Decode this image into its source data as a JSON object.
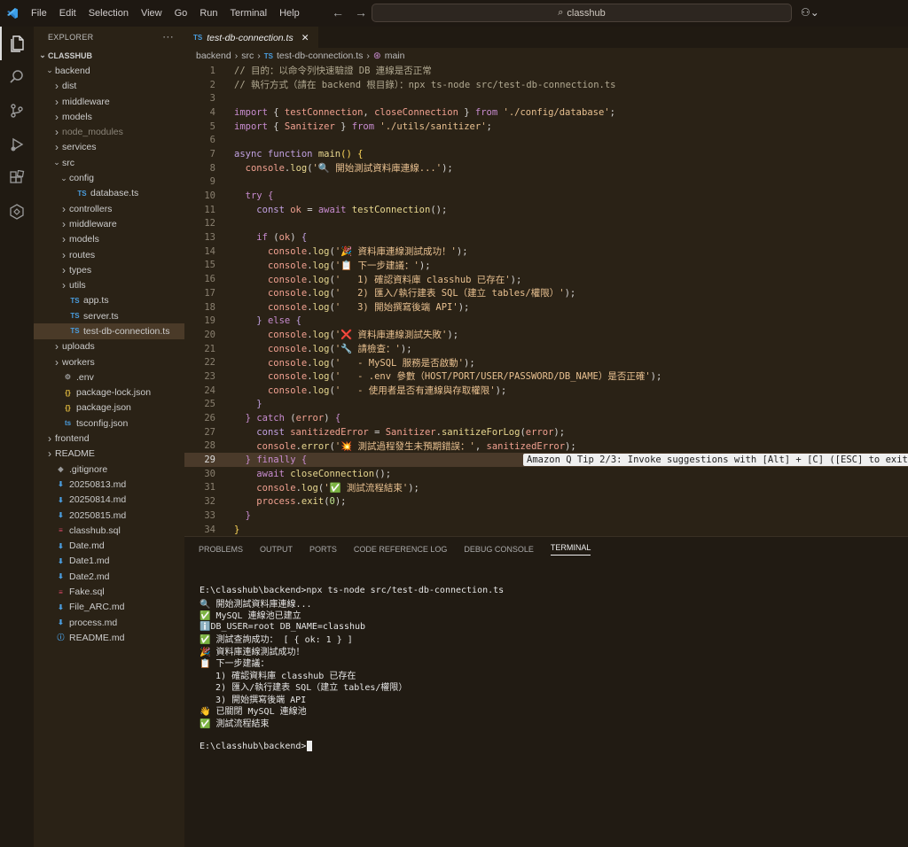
{
  "titlebar": {
    "menus": [
      "File",
      "Edit",
      "Selection",
      "View",
      "Go",
      "Run",
      "Terminal",
      "Help"
    ],
    "search": "classhub"
  },
  "explorer": {
    "title": "EXPLORER",
    "root": "CLASSHUB",
    "items": [
      {
        "label": "backend",
        "depth": 1,
        "type": "folder-open"
      },
      {
        "label": "dist",
        "depth": 2,
        "type": "folder"
      },
      {
        "label": "middleware",
        "depth": 2,
        "type": "folder"
      },
      {
        "label": "models",
        "depth": 2,
        "type": "folder"
      },
      {
        "label": "node_modules",
        "depth": 2,
        "type": "folder",
        "dim": true
      },
      {
        "label": "services",
        "depth": 2,
        "type": "folder"
      },
      {
        "label": "src",
        "depth": 2,
        "type": "folder-open"
      },
      {
        "label": "config",
        "depth": 3,
        "type": "folder-open"
      },
      {
        "label": "database.ts",
        "depth": 4,
        "type": "ts"
      },
      {
        "label": "controllers",
        "depth": 3,
        "type": "folder"
      },
      {
        "label": "middleware",
        "depth": 3,
        "type": "folder"
      },
      {
        "label": "models",
        "depth": 3,
        "type": "folder"
      },
      {
        "label": "routes",
        "depth": 3,
        "type": "folder"
      },
      {
        "label": "types",
        "depth": 3,
        "type": "folder"
      },
      {
        "label": "utils",
        "depth": 3,
        "type": "folder"
      },
      {
        "label": "app.ts",
        "depth": 3,
        "type": "ts"
      },
      {
        "label": "server.ts",
        "depth": 3,
        "type": "ts"
      },
      {
        "label": "test-db-connection.ts",
        "depth": 3,
        "type": "ts",
        "selected": true
      },
      {
        "label": "uploads",
        "depth": 2,
        "type": "folder"
      },
      {
        "label": "workers",
        "depth": 2,
        "type": "folder"
      },
      {
        "label": ".env",
        "depth": 2,
        "type": "env"
      },
      {
        "label": "package-lock.json",
        "depth": 2,
        "type": "json"
      },
      {
        "label": "package.json",
        "depth": 2,
        "type": "json"
      },
      {
        "label": "tsconfig.json",
        "depth": 2,
        "type": "tsconfig"
      },
      {
        "label": "frontend",
        "depth": 1,
        "type": "folder"
      },
      {
        "label": "README",
        "depth": 1,
        "type": "folder"
      },
      {
        "label": ".gitignore",
        "depth": 1,
        "type": "git"
      },
      {
        "label": "20250813.md",
        "depth": 1,
        "type": "md"
      },
      {
        "label": "20250814.md",
        "depth": 1,
        "type": "md"
      },
      {
        "label": "20250815.md",
        "depth": 1,
        "type": "md"
      },
      {
        "label": "classhub.sql",
        "depth": 1,
        "type": "sql"
      },
      {
        "label": "Date.md",
        "depth": 1,
        "type": "md"
      },
      {
        "label": "Date1.md",
        "depth": 1,
        "type": "md"
      },
      {
        "label": "Date2.md",
        "depth": 1,
        "type": "md"
      },
      {
        "label": "Fake.sql",
        "depth": 1,
        "type": "sql"
      },
      {
        "label": "File_ARC.md",
        "depth": 1,
        "type": "md"
      },
      {
        "label": "process.md",
        "depth": 1,
        "type": "md"
      },
      {
        "label": "README.md",
        "depth": 1,
        "type": "info"
      }
    ]
  },
  "editor": {
    "tab_label": "test-db-connection.ts",
    "tab_badge": "TS",
    "breadcrumb": [
      "backend",
      "src",
      "test-db-connection.ts",
      "main"
    ],
    "current_line": 29,
    "tip": "Amazon Q Tip 2/3: Invoke suggestions with [Alt] + [C] ([ESC] to exit)",
    "lines": [
      [
        [
          "c-com",
          "// 目的：以命令列快速驗證 DB 連線是否正常"
        ]
      ],
      [
        [
          "c-com",
          "// 執行方式（請在 backend 根目錄）：npx ts-node src/test-db-connection.ts"
        ]
      ],
      [
        [
          "",
          ""
        ]
      ],
      [
        [
          "c-kw",
          "import"
        ],
        [
          "",
          " { "
        ],
        [
          "c-var",
          "testConnection"
        ],
        [
          "",
          ", "
        ],
        [
          "c-var",
          "closeConnection"
        ],
        [
          "",
          " } "
        ],
        [
          "c-kw",
          "from"
        ],
        [
          "",
          " "
        ],
        [
          "c-str",
          "'./config/database'"
        ],
        [
          "",
          ";"
        ]
      ],
      [
        [
          "c-kw",
          "import"
        ],
        [
          "",
          " { "
        ],
        [
          "c-var",
          "Sanitizer"
        ],
        [
          "",
          " } "
        ],
        [
          "c-kw",
          "from"
        ],
        [
          "",
          " "
        ],
        [
          "c-str",
          "'./utils/sanitizer'"
        ],
        [
          "",
          ";"
        ]
      ],
      [
        [
          "",
          ""
        ]
      ],
      [
        [
          "c-kw2",
          "async function"
        ],
        [
          "",
          " "
        ],
        [
          "c-fn",
          "main"
        ],
        [
          "c-yellow",
          "()"
        ],
        [
          "",
          " "
        ],
        [
          "c-yellow",
          "{"
        ]
      ],
      [
        [
          "",
          "  "
        ],
        [
          "c-var",
          "console"
        ],
        [
          "",
          "."
        ],
        [
          "c-fn",
          "log"
        ],
        [
          "",
          "("
        ],
        [
          "c-str",
          "'🔍 開始測試資料庫連線...'"
        ],
        [
          "",
          ");"
        ]
      ],
      [
        [
          "",
          ""
        ]
      ],
      [
        [
          "",
          "  "
        ],
        [
          "c-kw",
          "try"
        ],
        [
          "",
          " "
        ],
        [
          "c-kw",
          "{"
        ]
      ],
      [
        [
          "",
          "    "
        ],
        [
          "c-kw2",
          "const"
        ],
        [
          "",
          " "
        ],
        [
          "c-var",
          "ok"
        ],
        [
          "",
          " = "
        ],
        [
          "c-kw",
          "await"
        ],
        [
          "",
          " "
        ],
        [
          "c-fn",
          "testConnection"
        ],
        [
          "",
          "();"
        ]
      ],
      [
        [
          "",
          ""
        ]
      ],
      [
        [
          "",
          "    "
        ],
        [
          "c-kw",
          "if"
        ],
        [
          "",
          " ("
        ],
        [
          "c-var",
          "ok"
        ],
        [
          "",
          ") "
        ],
        [
          "c-kw2",
          "{"
        ]
      ],
      [
        [
          "",
          "      "
        ],
        [
          "c-var",
          "console"
        ],
        [
          "",
          "."
        ],
        [
          "c-fn",
          "log"
        ],
        [
          "",
          "("
        ],
        [
          "c-str",
          "'🎉 資料庫連線測試成功！'"
        ],
        [
          "",
          ");"
        ]
      ],
      [
        [
          "",
          "      "
        ],
        [
          "c-var",
          "console"
        ],
        [
          "",
          "."
        ],
        [
          "c-fn",
          "log"
        ],
        [
          "",
          "("
        ],
        [
          "c-str",
          "'📋 下一步建議：'"
        ],
        [
          "",
          ");"
        ]
      ],
      [
        [
          "",
          "      "
        ],
        [
          "c-var",
          "console"
        ],
        [
          "",
          "."
        ],
        [
          "c-fn",
          "log"
        ],
        [
          "",
          "("
        ],
        [
          "c-str",
          "'   1) 確認資料庫 classhub 已存在'"
        ],
        [
          "",
          ");"
        ]
      ],
      [
        [
          "",
          "      "
        ],
        [
          "c-var",
          "console"
        ],
        [
          "",
          "."
        ],
        [
          "c-fn",
          "log"
        ],
        [
          "",
          "("
        ],
        [
          "c-str",
          "'   2) 匯入/執行建表 SQL（建立 tables/權限）'"
        ],
        [
          "",
          ");"
        ]
      ],
      [
        [
          "",
          "      "
        ],
        [
          "c-var",
          "console"
        ],
        [
          "",
          "."
        ],
        [
          "c-fn",
          "log"
        ],
        [
          "",
          "("
        ],
        [
          "c-str",
          "'   3) 開始撰寫後端 API'"
        ],
        [
          "",
          ");"
        ]
      ],
      [
        [
          "",
          "    "
        ],
        [
          "c-kw2",
          "}"
        ],
        [
          "",
          " "
        ],
        [
          "c-kw",
          "else"
        ],
        [
          "",
          " "
        ],
        [
          "c-kw2",
          "{"
        ]
      ],
      [
        [
          "",
          "      "
        ],
        [
          "c-var",
          "console"
        ],
        [
          "",
          "."
        ],
        [
          "c-fn",
          "log"
        ],
        [
          "",
          "("
        ],
        [
          "c-str",
          "'❌ 資料庫連線測試失敗'"
        ],
        [
          "",
          ");"
        ]
      ],
      [
        [
          "",
          "      "
        ],
        [
          "c-var",
          "console"
        ],
        [
          "",
          "."
        ],
        [
          "c-fn",
          "log"
        ],
        [
          "",
          "("
        ],
        [
          "c-str",
          "'🔧 請檢查：'"
        ],
        [
          "",
          ");"
        ]
      ],
      [
        [
          "",
          "      "
        ],
        [
          "c-var",
          "console"
        ],
        [
          "",
          "."
        ],
        [
          "c-fn",
          "log"
        ],
        [
          "",
          "("
        ],
        [
          "c-str",
          "'   - MySQL 服務是否啟動'"
        ],
        [
          "",
          ");"
        ]
      ],
      [
        [
          "",
          "      "
        ],
        [
          "c-var",
          "console"
        ],
        [
          "",
          "."
        ],
        [
          "c-fn",
          "log"
        ],
        [
          "",
          "("
        ],
        [
          "c-str",
          "'   - .env 參數（HOST/PORT/USER/PASSWORD/DB_NAME）是否正確'"
        ],
        [
          "",
          ");"
        ]
      ],
      [
        [
          "",
          "      "
        ],
        [
          "c-var",
          "console"
        ],
        [
          "",
          "."
        ],
        [
          "c-fn",
          "log"
        ],
        [
          "",
          "("
        ],
        [
          "c-str",
          "'   - 使用者是否有連線與存取權限'"
        ],
        [
          "",
          ");"
        ]
      ],
      [
        [
          "",
          "    "
        ],
        [
          "c-kw2",
          "}"
        ]
      ],
      [
        [
          "",
          "  "
        ],
        [
          "c-kw",
          "}"
        ],
        [
          "",
          " "
        ],
        [
          "c-kw",
          "catch"
        ],
        [
          "",
          " ("
        ],
        [
          "c-var",
          "error"
        ],
        [
          "",
          ") "
        ],
        [
          "c-kw",
          "{"
        ]
      ],
      [
        [
          "",
          "    "
        ],
        [
          "c-kw2",
          "const"
        ],
        [
          "",
          " "
        ],
        [
          "c-var",
          "sanitizedError"
        ],
        [
          "",
          " = "
        ],
        [
          "c-var",
          "Sanitizer"
        ],
        [
          "",
          "."
        ],
        [
          "c-fn",
          "sanitizeForLog"
        ],
        [
          "",
          "("
        ],
        [
          "c-var",
          "error"
        ],
        [
          "",
          ");"
        ]
      ],
      [
        [
          "",
          "    "
        ],
        [
          "c-var",
          "console"
        ],
        [
          "",
          "."
        ],
        [
          "c-fn",
          "error"
        ],
        [
          "",
          "("
        ],
        [
          "c-str",
          "'💥 測試過程發生未預期錯誤：'"
        ],
        [
          "",
          ", "
        ],
        [
          "c-var",
          "sanitizedError"
        ],
        [
          "",
          ");"
        ]
      ],
      [
        [
          "",
          "  "
        ],
        [
          "c-kw",
          "}"
        ],
        [
          "",
          " "
        ],
        [
          "c-kw",
          "finally"
        ],
        [
          "",
          " "
        ],
        [
          "c-kw",
          "{"
        ]
      ],
      [
        [
          "",
          "    "
        ],
        [
          "c-kw",
          "await"
        ],
        [
          "",
          " "
        ],
        [
          "c-fn",
          "closeConnection"
        ],
        [
          "",
          "();"
        ]
      ],
      [
        [
          "",
          "    "
        ],
        [
          "c-var",
          "console"
        ],
        [
          "",
          "."
        ],
        [
          "c-fn",
          "log"
        ],
        [
          "",
          "("
        ],
        [
          "c-str",
          "'✅ 測試流程結束'"
        ],
        [
          "",
          ");"
        ]
      ],
      [
        [
          "",
          "    "
        ],
        [
          "c-var",
          "process"
        ],
        [
          "",
          "."
        ],
        [
          "c-fn",
          "exit"
        ],
        [
          "",
          "("
        ],
        [
          "c-num",
          "0"
        ],
        [
          "",
          ");"
        ]
      ],
      [
        [
          "",
          "  "
        ],
        [
          "c-kw",
          "}"
        ]
      ],
      [
        [
          "c-yellow",
          "}"
        ]
      ]
    ]
  },
  "panel": {
    "tabs": [
      "PROBLEMS",
      "OUTPUT",
      "PORTS",
      "CODE REFERENCE LOG",
      "DEBUG CONSOLE",
      "TERMINAL"
    ],
    "active_tab": "TERMINAL",
    "terminal_lines": [
      "E:\\classhub\\backend>npx ts-node src/test-db-connection.ts",
      "🔍 開始測試資料庫連線...",
      "✅ MySQL 連線池已建立",
      "ℹ️DB_USER=root DB_NAME=classhub",
      "✅ 測試查詢成功： [ { ok: 1 } ]",
      "🎉 資料庫連線測試成功！",
      "📋 下一步建議：",
      "   1) 確認資料庫 classhub 已存在",
      "   2) 匯入/執行建表 SQL（建立 tables/權限）",
      "   3) 開始撰寫後端 API",
      "👋 已關閉 MySQL 連線池",
      "✅ 測試流程結束",
      "",
      "E:\\classhub\\backend>"
    ]
  },
  "colors": {
    "accent": "#4a9ee0",
    "selection": "#4a3a28"
  }
}
